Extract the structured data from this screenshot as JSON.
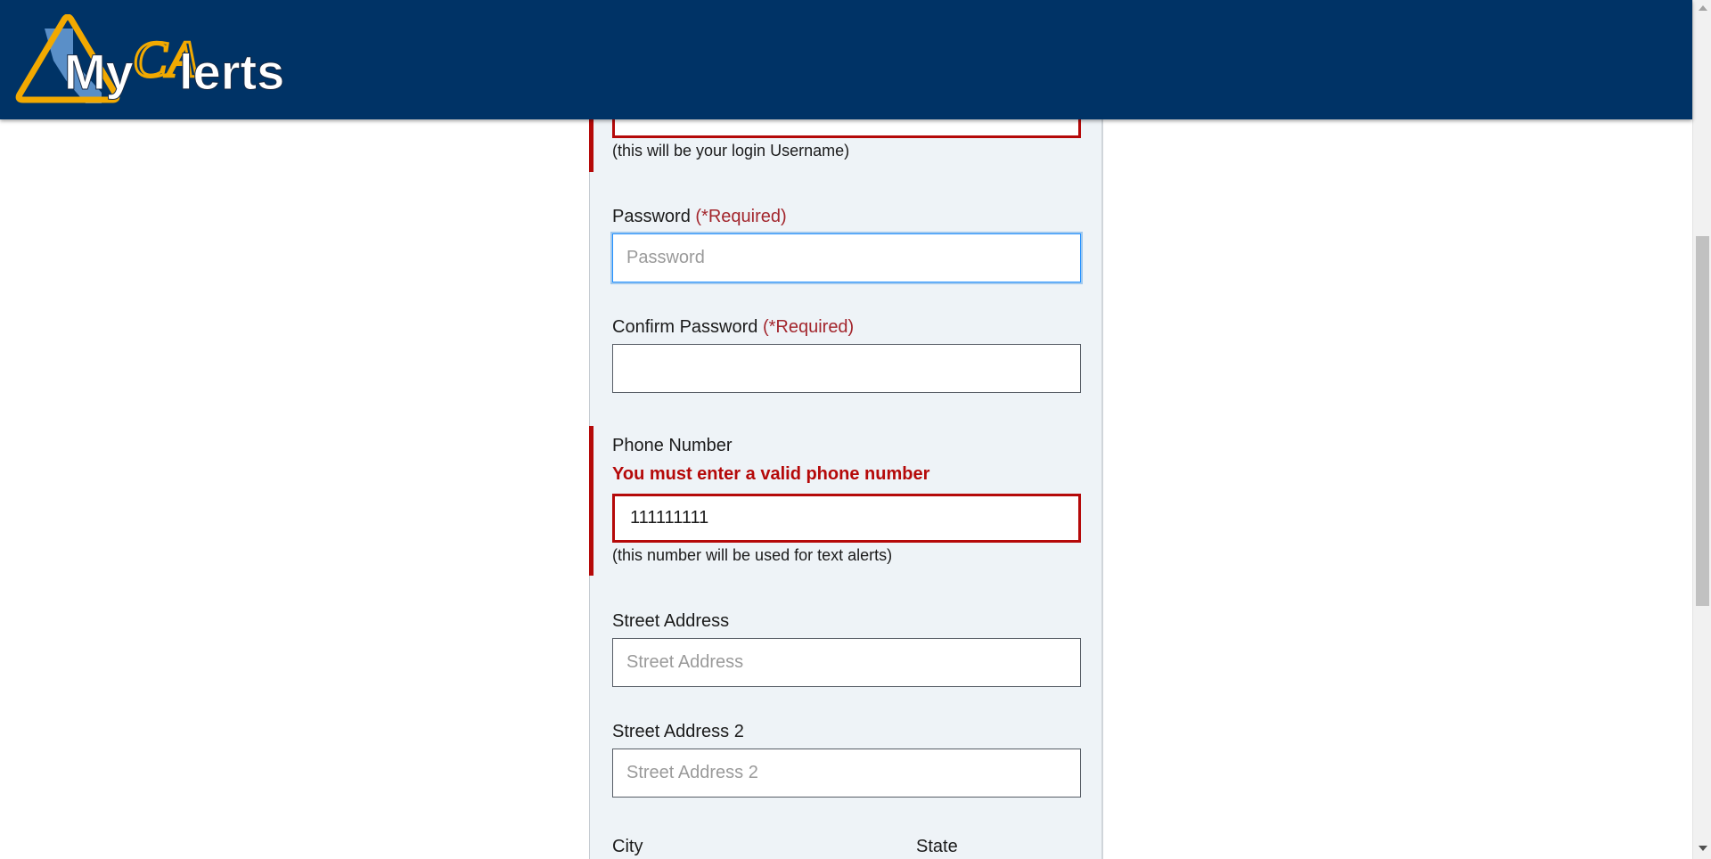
{
  "header": {
    "logo": {
      "text_my": "My",
      "text_ca": "CA",
      "text_alerts": "lerts"
    },
    "colors": {
      "background": "#003366",
      "logo_accent": "#f2a900",
      "state_blue": "#5a8fc8"
    }
  },
  "form": {
    "email_hint": "(this will be your login Username)",
    "password": {
      "label": "Password",
      "required": "(*Required)",
      "placeholder": "Password",
      "value": ""
    },
    "confirm_password": {
      "label": "Confirm Password",
      "required": "(*Required)",
      "value": ""
    },
    "phone": {
      "label": "Phone Number",
      "error": "You must enter a valid phone number",
      "value": "111111111",
      "hint": "(this number will be used for text alerts)"
    },
    "street_address": {
      "label": "Street Address",
      "placeholder": "Street Address"
    },
    "street_address_2": {
      "label": "Street Address 2",
      "placeholder": "Street Address 2"
    },
    "city": {
      "label": "City"
    },
    "state": {
      "label": "State"
    }
  },
  "colors": {
    "error": "#b50909",
    "required": "#a3262d",
    "focus": "#2491ff",
    "panel": "#eef3f7"
  }
}
